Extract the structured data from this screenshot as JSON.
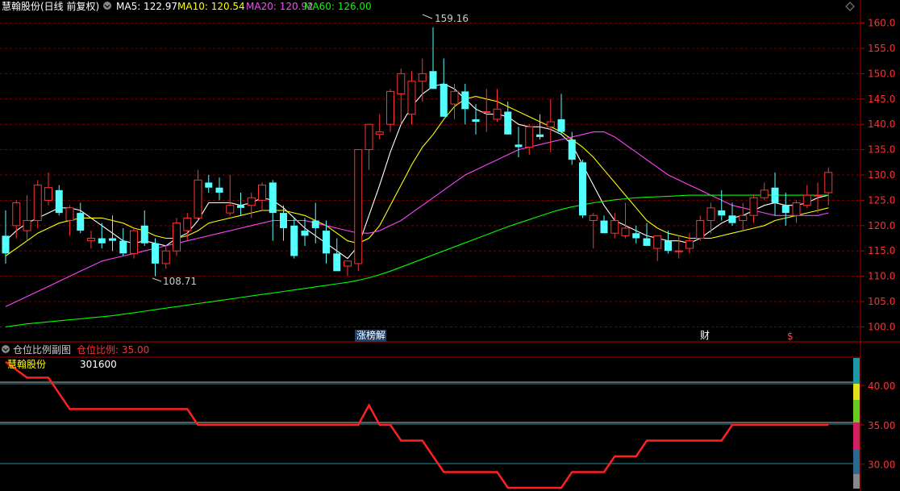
{
  "main_header": {
    "title": "慧翰股份(日线 前复权)",
    "ma5": "MA5: 122.97",
    "ma10": "MA10: 120.54",
    "ma20": "MA20: 120.92",
    "ma60": "MA60: 126.00",
    "colors": {
      "ma5": "#ffffff",
      "ma10": "#ffff00",
      "ma20": "#ff44ff",
      "ma60": "#00ff00"
    }
  },
  "annotations": {
    "high": "159.16",
    "low": "108.71",
    "tag_zhangtingjie": "涨榜解",
    "tag_cai": "财",
    "tag_dollar": "$"
  },
  "sub_header": {
    "title": "仓位比例副图",
    "value_text": "仓位比例: 35.00",
    "stock_name": "慧翰股份",
    "stock_code": "301600"
  },
  "chart_data": [
    {
      "type": "candlestick",
      "title": "慧翰股份(日线 前复权)",
      "yticks": [
        100,
        105,
        110,
        115,
        120,
        125,
        130,
        135,
        140,
        145,
        150,
        155,
        160
      ],
      "ylim": [
        98,
        162
      ],
      "grid": true,
      "colors": {
        "up": "#ff3232",
        "down": "#54ffff"
      },
      "candles": [
        [
          118.0,
          123.0,
          112.5,
          114.5
        ],
        [
          120.0,
          125.0,
          117.5,
          124.5
        ],
        [
          119.0,
          126.0,
          117.0,
          121.0
        ],
        [
          121.0,
          129.0,
          119.5,
          128.0
        ],
        [
          125.0,
          130.5,
          124.0,
          127.5
        ],
        [
          127.0,
          128.0,
          122.0,
          122.5
        ],
        [
          121.0,
          124.0,
          118.0,
          123.5
        ],
        [
          122.5,
          124.5,
          118.5,
          119.0
        ],
        [
          117.0,
          119.0,
          115.5,
          117.5
        ],
        [
          117.5,
          120.5,
          115.5,
          116.5
        ],
        [
          117.5,
          122.0,
          115.0,
          117.0
        ],
        [
          117.0,
          119.5,
          114.0,
          114.5
        ],
        [
          114.5,
          119.5,
          113.5,
          119.0
        ],
        [
          120.0,
          123.0,
          116.0,
          116.5
        ],
        [
          116.5,
          117.5,
          110.0,
          112.5
        ],
        [
          112.5,
          116.0,
          111.5,
          115.0
        ],
        [
          115.0,
          121.5,
          114.0,
          120.5
        ],
        [
          119.0,
          122.5,
          117.0,
          121.5
        ],
        [
          121.5,
          131.0,
          121.0,
          129.0
        ],
        [
          128.5,
          130.0,
          126.5,
          127.5
        ],
        [
          127.5,
          129.5,
          125.0,
          126.5
        ],
        [
          122.5,
          130.0,
          122.0,
          124.0
        ],
        [
          124.0,
          126.5,
          122.0,
          123.5
        ],
        [
          124.0,
          126.5,
          121.5,
          125.5
        ],
        [
          125.0,
          128.5,
          123.0,
          128.0
        ],
        [
          128.5,
          129.0,
          117.0,
          122.5
        ],
        [
          122.5,
          124.0,
          117.0,
          119.5
        ],
        [
          120.0,
          121.5,
          113.5,
          114.0
        ],
        [
          119.0,
          121.5,
          116.0,
          118.0
        ],
        [
          121.0,
          124.5,
          116.5,
          119.5
        ],
        [
          119.0,
          121.0,
          112.5,
          114.5
        ],
        [
          114.5,
          117.5,
          111.0,
          111.0
        ],
        [
          112.0,
          112.5,
          110.0,
          113.0
        ],
        [
          112.5,
          135.0,
          111.0,
          135.0
        ],
        [
          135.0,
          140.0,
          131.0,
          140.0
        ],
        [
          138.0,
          142.0,
          137.0,
          138.5
        ],
        [
          140.0,
          147.0,
          138.5,
          146.5
        ],
        [
          146.0,
          151.0,
          140.0,
          150.0
        ],
        [
          142.0,
          150.5,
          140.0,
          148.5
        ],
        [
          148.5,
          153.0,
          144.5,
          150.0
        ],
        [
          150.5,
          159.16,
          148.0,
          147.0
        ],
        [
          148.0,
          153.0,
          143.5,
          141.5
        ],
        [
          144.0,
          148.0,
          141.0,
          146.5
        ],
        [
          146.5,
          148.0,
          140.0,
          143.0
        ],
        [
          141.0,
          144.0,
          138.0,
          140.5
        ],
        [
          142.5,
          147.0,
          138.5,
          142.5
        ],
        [
          141.0,
          147.0,
          140.5,
          143.0
        ],
        [
          142.5,
          144.5,
          139.0,
          138.0
        ],
        [
          136.0,
          139.5,
          133.5,
          135.5
        ],
        [
          135.5,
          140.0,
          134.0,
          139.5
        ],
        [
          138.0,
          142.0,
          137.0,
          137.5
        ],
        [
          139.5,
          145.0,
          134.5,
          140.5
        ],
        [
          141.0,
          146.0,
          138.0,
          138.5
        ],
        [
          137.0,
          138.5,
          132.0,
          133.0
        ],
        [
          132.5,
          133.0,
          121.5,
          122.0
        ],
        [
          121.0,
          122.5,
          115.5,
          122.0
        ],
        [
          121.0,
          122.0,
          119.0,
          118.5
        ],
        [
          118.5,
          122.5,
          117.5,
          121.0
        ],
        [
          118.0,
          124.5,
          117.5,
          119.5
        ],
        [
          118.5,
          120.0,
          116.5,
          117.5
        ],
        [
          117.5,
          120.5,
          116.5,
          116.0
        ],
        [
          115.5,
          117.5,
          113.0,
          118.0
        ],
        [
          117.0,
          119.0,
          114.5,
          115.0
        ],
        [
          115.0,
          118.0,
          113.5,
          115.0
        ],
        [
          115.5,
          118.5,
          114.5,
          117.0
        ],
        [
          117.5,
          122.0,
          117.0,
          121.0
        ],
        [
          121.0,
          124.5,
          118.5,
          123.5
        ],
        [
          123.0,
          127.0,
          121.0,
          122.0
        ],
        [
          122.0,
          124.5,
          120.0,
          120.5
        ],
        [
          121.0,
          124.5,
          119.0,
          122.0
        ],
        [
          122.0,
          126.0,
          120.5,
          125.5
        ],
        [
          125.5,
          128.5,
          125.0,
          127.0
        ],
        [
          127.5,
          130.5,
          122.0,
          124.5
        ],
        [
          124.0,
          126.5,
          120.0,
          122.5
        ],
        [
          122.0,
          125.0,
          120.5,
          124.5
        ],
        [
          124.0,
          128.0,
          123.5,
          126.0
        ],
        [
          126.0,
          128.5,
          122.5,
          126.0
        ],
        [
          126.5,
          131.5,
          124.0,
          130.5
        ]
      ],
      "series": [
        {
          "name": "MA5",
          "color": "#ffffff",
          "values": [
            117,
            119,
            120.5,
            121.5,
            122.5,
            123.5,
            123.5,
            123,
            121.5,
            120,
            118.5,
            117,
            116.5,
            117,
            116.5,
            116,
            117.5,
            118.5,
            121,
            124.5,
            124.5,
            124.5,
            124,
            124.5,
            125.5,
            125,
            123.5,
            121.5,
            119.5,
            118,
            116.5,
            115,
            113.5,
            116,
            122,
            128,
            134.5,
            140,
            143.5,
            146,
            147.5,
            148,
            147,
            145,
            143,
            142,
            142,
            141.5,
            140,
            139.5,
            139.5,
            139,
            138,
            136,
            132,
            128,
            124,
            121,
            120,
            119,
            118,
            117.5,
            117,
            117,
            116.5,
            117.5,
            119,
            120.5,
            121.5,
            122,
            123,
            124,
            124.5,
            124,
            124,
            124.5,
            125.5,
            126
          ]
        },
        {
          "name": "MA10",
          "color": "#ffff00",
          "values": [
            114,
            115.5,
            117,
            118.5,
            119.5,
            120.5,
            121,
            121.5,
            121.5,
            121.5,
            121,
            120.5,
            119.5,
            119,
            118,
            117.5,
            117.5,
            118,
            119,
            120.5,
            121,
            121.5,
            122,
            122.5,
            123,
            123,
            123,
            122.5,
            122,
            121,
            120,
            118.5,
            117,
            116.5,
            117.5,
            120,
            124,
            128,
            132,
            135.5,
            138,
            141,
            143.5,
            145,
            145.5,
            145,
            144.5,
            143.5,
            142.5,
            141.5,
            140.5,
            139.5,
            138.5,
            137,
            135.5,
            133.5,
            131,
            128.5,
            126,
            123.5,
            121,
            119.5,
            118.5,
            118,
            117.5,
            117.5,
            117.5,
            118,
            118.5,
            119,
            119.5,
            120,
            121,
            121.5,
            122,
            122.5,
            123,
            123.5
          ]
        },
        {
          "name": "MA20",
          "color": "#ff44ff",
          "values": [
            104,
            105,
            106,
            107,
            108,
            109,
            110,
            111,
            112,
            113,
            113.5,
            114,
            114.5,
            115,
            115.5,
            116,
            116.5,
            117,
            117.5,
            118,
            118.5,
            119,
            119.5,
            120,
            120.5,
            121,
            121,
            121,
            121,
            120.5,
            120,
            119.5,
            119,
            118.5,
            118.5,
            119,
            120,
            121,
            122.5,
            124,
            125.5,
            127,
            128.5,
            130,
            131,
            132,
            133,
            134,
            135,
            135.5,
            136,
            136.5,
            137,
            137.5,
            138,
            138.5,
            138.5,
            137.5,
            136,
            134.5,
            133,
            131.5,
            130,
            129,
            128,
            127,
            126,
            125,
            124,
            123.5,
            123,
            122.5,
            122,
            122,
            122,
            122,
            122,
            122.5
          ]
        },
        {
          "name": "MA60",
          "color": "#00ff00",
          "values": [
            100,
            100.3,
            100.6,
            100.8,
            101,
            101.2,
            101.4,
            101.6,
            101.8,
            102,
            102.2,
            102.5,
            102.8,
            103.1,
            103.4,
            103.7,
            104,
            104.3,
            104.6,
            104.9,
            105.2,
            105.5,
            105.8,
            106.1,
            106.4,
            106.7,
            107,
            107.3,
            107.6,
            107.9,
            108.2,
            108.5,
            108.8,
            109.2,
            109.7,
            110.3,
            111,
            111.8,
            112.6,
            113.4,
            114.2,
            115,
            115.8,
            116.6,
            117.4,
            118.2,
            119,
            119.8,
            120.5,
            121.2,
            121.9,
            122.6,
            123.2,
            123.7,
            124.1,
            124.5,
            124.8,
            125.1,
            125.3,
            125.5,
            125.6,
            125.7,
            125.8,
            125.9,
            126,
            126,
            126,
            126,
            126,
            126,
            126,
            126,
            126,
            126,
            126,
            126,
            126,
            126
          ]
        }
      ]
    },
    {
      "type": "line",
      "title": "仓位比例副图",
      "yticks": [
        30,
        35,
        40
      ],
      "ylim": [
        26.9,
        43.5
      ],
      "series": [
        {
          "name": "仓位比例",
          "color": "#ff2020",
          "values": [
            43,
            42,
            41,
            41,
            41,
            39,
            37,
            37,
            37,
            37,
            37,
            37,
            37,
            37,
            37,
            37,
            37,
            37,
            35,
            35,
            35,
            35,
            35,
            35,
            35,
            35,
            35,
            35,
            35,
            35,
            35,
            35,
            35,
            35,
            37.5,
            35,
            35,
            33,
            33,
            33,
            31,
            29,
            29,
            29,
            29,
            29,
            29,
            27,
            27,
            27,
            27,
            27,
            27,
            29,
            29,
            29,
            29,
            31,
            31,
            31,
            33,
            33,
            33,
            33,
            33,
            33,
            33,
            33,
            35,
            35,
            35,
            35,
            35,
            35,
            35,
            35,
            35,
            35
          ]
        }
      ]
    }
  ]
}
